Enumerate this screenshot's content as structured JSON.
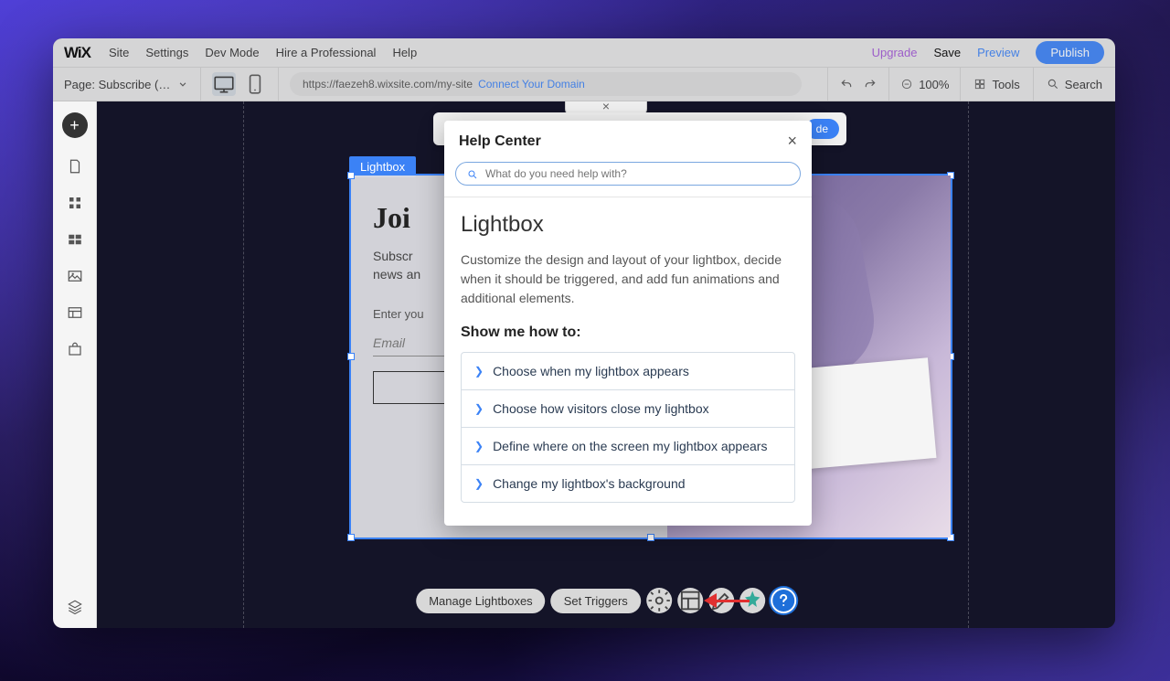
{
  "topbar": {
    "logo": "WiX",
    "menu": [
      "Site",
      "Settings",
      "Dev Mode",
      "Hire a Professional",
      "Help"
    ],
    "upgrade": "Upgrade",
    "save": "Save",
    "preview": "Preview",
    "publish": "Publish"
  },
  "toolbar": {
    "page_label": "Page: Subscribe (…",
    "url": "https://faezeh8.wixsite.com/my-site",
    "connect": "Connect Your Domain",
    "zoom": "100%",
    "tools": "Tools",
    "search": "Search"
  },
  "stage": {
    "tab_close": "×",
    "float_pill": "de"
  },
  "lightbox": {
    "tag": "Lightbox",
    "title": "Joi",
    "subtitle_line1": "Subscr",
    "subtitle_line2": "news an",
    "email_label": "Enter you",
    "email_placeholder": "Email"
  },
  "actionbar": {
    "manage": "Manage Lightboxes",
    "triggers": "Set Triggers"
  },
  "help": {
    "title": "Help Center",
    "search_placeholder": "What do you need help with?",
    "topic": "Lightbox",
    "description": "Customize the design and layout of your lightbox, decide when it should be triggered, and add fun animations and additional elements.",
    "showme": "Show me how to:",
    "items": [
      "Choose when my lightbox appears",
      "Choose how visitors close my lightbox",
      "Define where on the screen my lightbox appears",
      "Change my lightbox's background"
    ]
  }
}
